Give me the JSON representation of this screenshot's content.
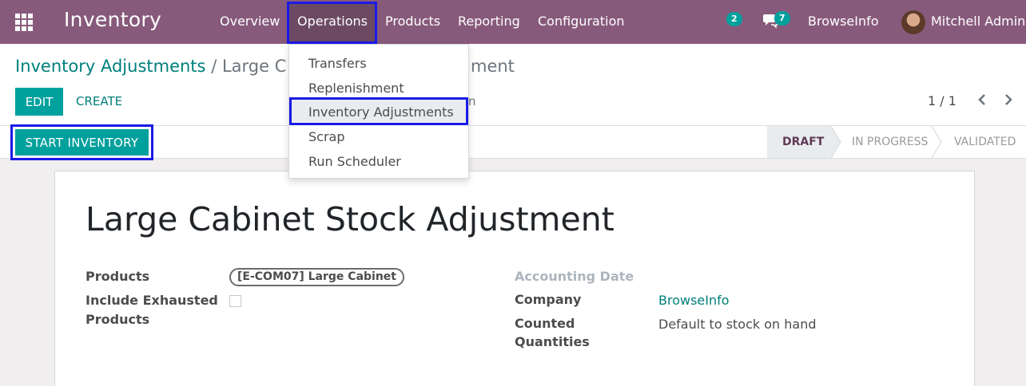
{
  "navbar": {
    "app_title": "Inventory",
    "menu": [
      "Overview",
      "Operations",
      "Products",
      "Reporting",
      "Configuration"
    ],
    "activity_count": "2",
    "messages_count": "7",
    "company": "BrowseInfo",
    "user": "Mitchell Admin"
  },
  "breadcrumb": {
    "parent": "Inventory Adjustments",
    "separator": "/",
    "current": "Large C",
    "current_tail": "ment"
  },
  "buttons": {
    "edit": "EDIT",
    "create": "CREATE",
    "start_inventory": "START INVENTORY",
    "partial_text": "n"
  },
  "pager": {
    "value": "1 / 1",
    "prev": "‹",
    "next": "›"
  },
  "status": {
    "stages": [
      "DRAFT",
      "IN PROGRESS",
      "VALIDATED"
    ],
    "active": "DRAFT"
  },
  "dropdown": {
    "items": [
      "Transfers",
      "Replenishment",
      "Inventory Adjustments",
      "Scrap",
      "Run Scheduler"
    ],
    "highlighted": "Inventory Adjustments"
  },
  "form": {
    "title": "Large Cabinet Stock Adjustment",
    "products_label": "Products",
    "products_tag": "[E-COM07] Large Cabinet",
    "exhausted_label_1": "Include Exhausted",
    "exhausted_label_2": "Products",
    "accounting_date_label": "Accounting Date",
    "company_label": "Company",
    "company_value": "BrowseInfo",
    "counted_label_1": "Counted",
    "counted_label_2": "Quantities",
    "counted_value": "Default to stock on hand"
  },
  "colors": {
    "brand": "#875a7b",
    "accent": "#00a09d",
    "link": "#00807c",
    "highlight_border": "#1a1ae6"
  }
}
